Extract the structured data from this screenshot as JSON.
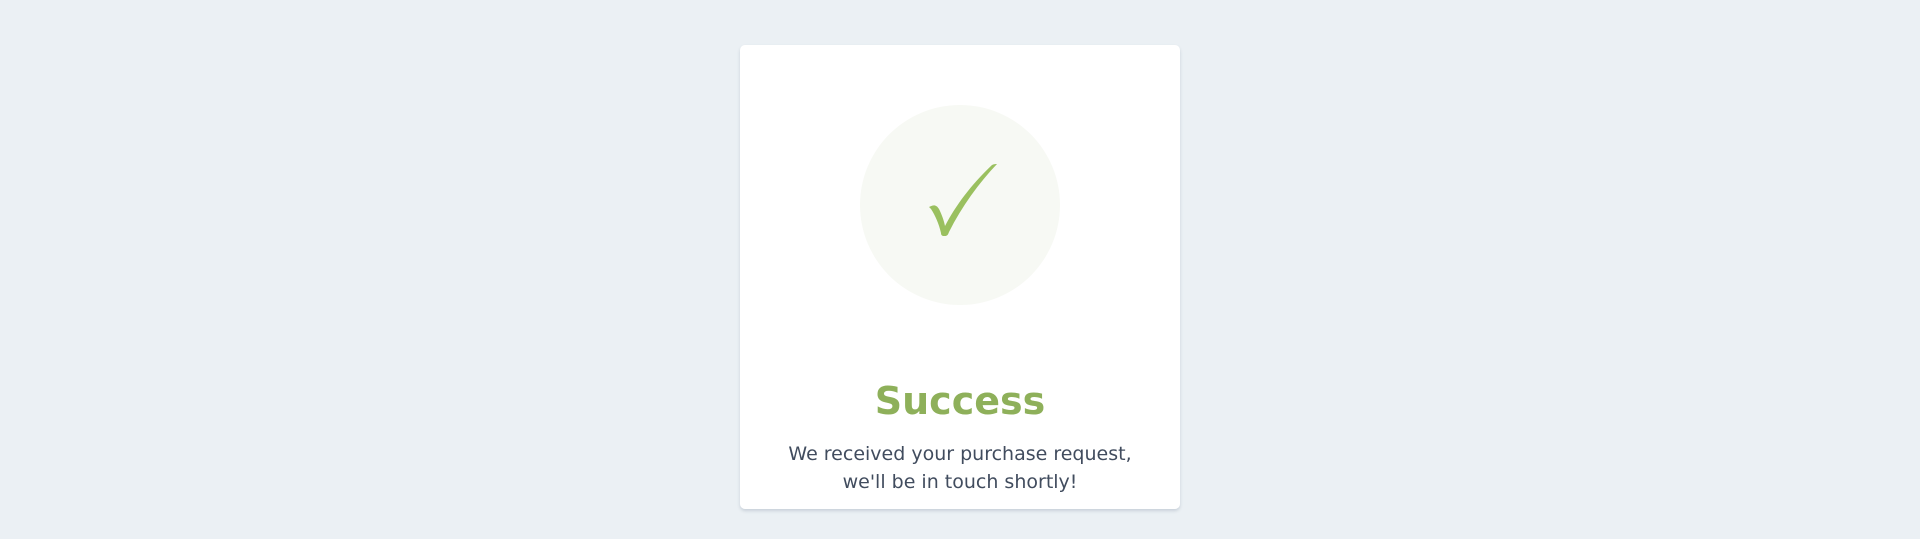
{
  "colors": {
    "page_background": "#ebf0f4",
    "card_background": "#ffffff",
    "accent_green": "#8eb05a",
    "icon_circle": "#f7f9f4",
    "checkmark": "#9ac05f",
    "body_text": "#414c5e"
  },
  "card": {
    "icon": "checkmark-icon",
    "title": "Success",
    "message_line1": "We received your purchase request,",
    "message_line2": "we'll be in touch shortly!"
  }
}
